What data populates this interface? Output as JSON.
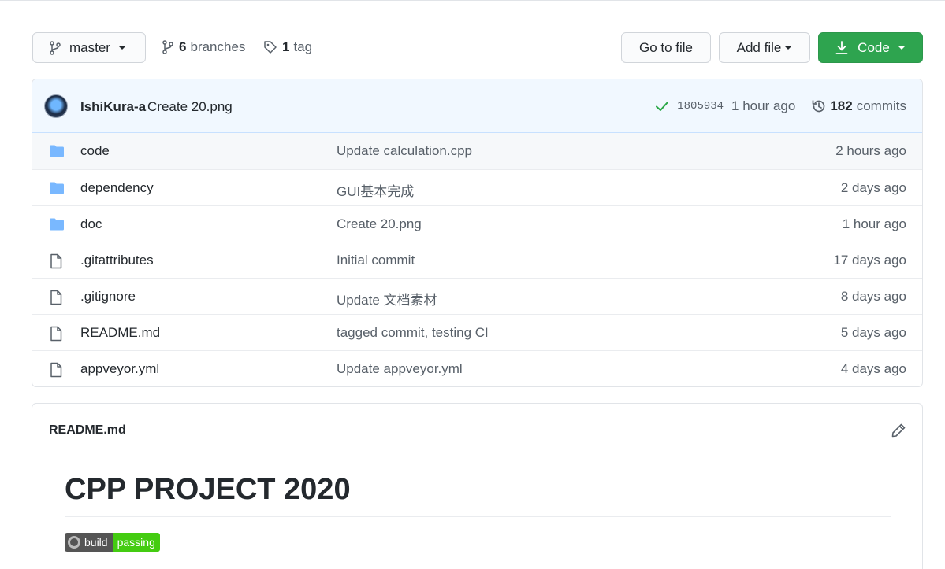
{
  "toolbar": {
    "branch_label": "master",
    "branches_count": "6",
    "branches_label": "branches",
    "tags_count": "1",
    "tags_label": "tag",
    "goto_file_label": "Go to file",
    "add_file_label": "Add file",
    "code_label": "Code",
    "code_color": "#2ea44f"
  },
  "latest_commit": {
    "author": "IshiKura-a",
    "message": "Create 20.png",
    "sha": "1805934",
    "time": "1 hour ago",
    "commits_count": "182",
    "commits_label": "commits"
  },
  "files": [
    {
      "type": "folder",
      "name": "code",
      "message": "Update calculation.cpp",
      "age": "2 hours ago"
    },
    {
      "type": "folder",
      "name": "dependency",
      "message": "GUI基本完成",
      "age": "2 days ago"
    },
    {
      "type": "folder",
      "name": "doc",
      "message": "Create 20.png",
      "age": "1 hour ago"
    },
    {
      "type": "file",
      "name": ".gitattributes",
      "message": "Initial commit",
      "age": "17 days ago"
    },
    {
      "type": "file",
      "name": ".gitignore",
      "message": "Update 文档素材",
      "age": "8 days ago"
    },
    {
      "type": "file",
      "name": "README.md",
      "message": "tagged commit, testing CI",
      "age": "5 days ago"
    },
    {
      "type": "file",
      "name": "appveyor.yml",
      "message": "Update appveyor.yml",
      "age": "4 days ago"
    }
  ],
  "readme": {
    "filename": "README.md",
    "heading": "CPP PROJECT 2020",
    "badge_left": "build",
    "badge_right": "passing"
  }
}
